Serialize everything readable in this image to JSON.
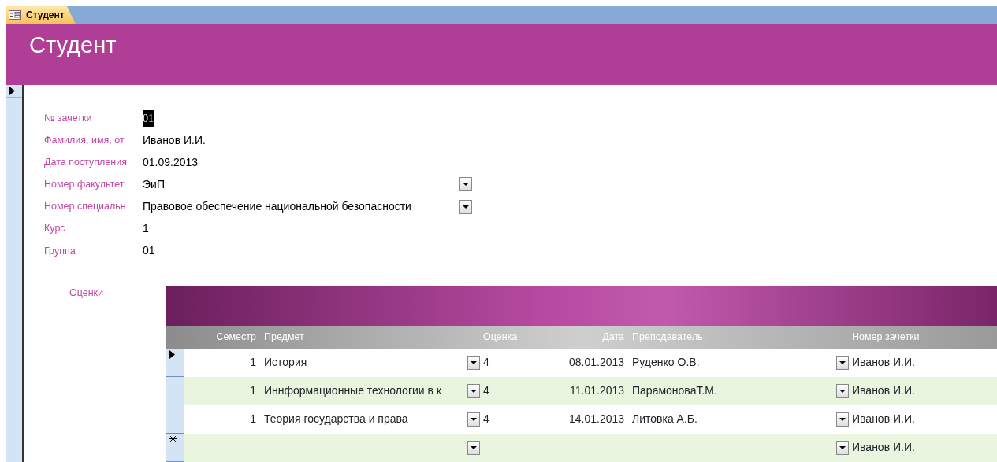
{
  "document_tab": {
    "title": "Студент",
    "selected": true
  },
  "header": {
    "title": "Студент"
  },
  "record_selector": {
    "current": true
  },
  "fields": [
    {
      "label": "№ зачетки",
      "value": "01",
      "kind": "text",
      "selected": true
    },
    {
      "label": "Фамилия, имя, от",
      "value": "Иванов И.И.",
      "kind": "text",
      "selected": false
    },
    {
      "label": "Дата поступления",
      "value": "01.09.2013",
      "kind": "text",
      "selected": false
    },
    {
      "label": "Номер факультет",
      "value": "ЭиП",
      "kind": "combo",
      "selected": false
    },
    {
      "label": "Номер специальн",
      "value": "Правовое обеспечение национальной безопасности",
      "kind": "combo",
      "selected": false
    },
    {
      "label": "Курс",
      "value": "1",
      "kind": "text",
      "selected": false
    },
    {
      "label": "Группа",
      "value": "01",
      "kind": "text",
      "selected": false
    }
  ],
  "subform": {
    "label": "Оценки",
    "columns": [
      "Семестр",
      "Предмет",
      "Оценка",
      "Дата",
      "Преподаватель",
      "Номер зачетки"
    ],
    "rows": [
      {
        "kind": "current",
        "semester": "1",
        "subject": "История",
        "grade": "4",
        "date": "08.01.2013",
        "teacher": "Руденко О.В.",
        "student": "Иванов И.И."
      },
      {
        "kind": "record",
        "semester": "1",
        "subject": "Иннформационные технологии в к",
        "grade": "4",
        "date": "11.01.2013",
        "teacher": "ПарамоноваТ.М.",
        "student": "Иванов И.И."
      },
      {
        "kind": "record",
        "semester": "1",
        "subject": "Теория государства и права",
        "grade": "4",
        "date": "14.01.2013",
        "teacher": "Литовка А.Б.",
        "student": "Иванов И.И."
      },
      {
        "kind": "new",
        "student": "Иванов И.И."
      }
    ]
  }
}
